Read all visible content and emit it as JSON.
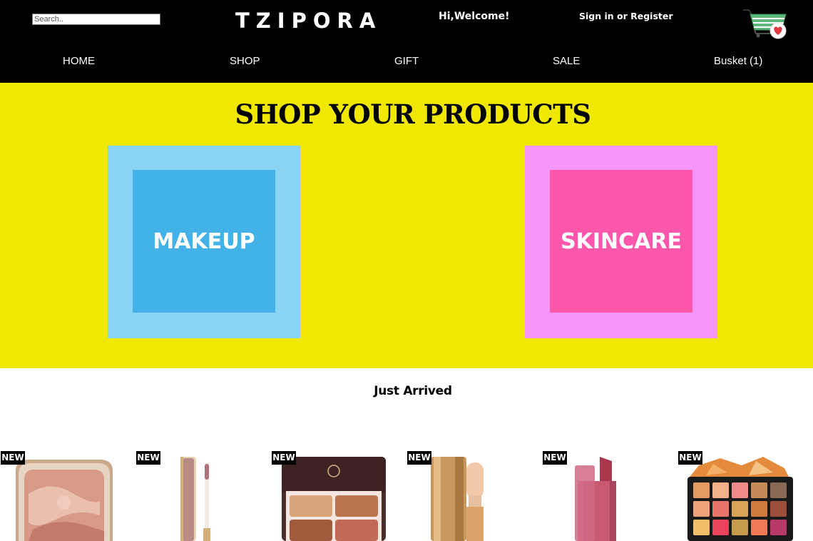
{
  "header": {
    "search_placeholder": "Search..",
    "logo": "TZIPORA",
    "welcome": "Hi,Welcome!",
    "signin": "Sign in or Register",
    "cart_icon": "shopping-cart-heart-icon"
  },
  "nav": {
    "items": [
      "HOME",
      "SHOP",
      "GIFT",
      "SALE",
      "Busket (1)"
    ]
  },
  "shop": {
    "title": "SHOP YOUR PRODUCTS",
    "categories": [
      {
        "label": "MAKEUP",
        "outer_color": "#89d3f5",
        "inner_color": "#43b2e9"
      },
      {
        "label": "SKINCARE",
        "outer_color": "#f696f8",
        "inner_color": "#fd57ac"
      }
    ],
    "band_color": "#f0e800"
  },
  "arrivals": {
    "title": "Just Arrived",
    "badge": "NEW",
    "products": [
      {
        "image": "marbled-blush-compact"
      },
      {
        "image": "lip-gloss-tube"
      },
      {
        "image": "eyeshadow-quad-palette"
      },
      {
        "image": "gold-lip-gloss-tube"
      },
      {
        "image": "pink-lipstick"
      },
      {
        "image": "eyeshadow-palette-orange"
      }
    ]
  }
}
